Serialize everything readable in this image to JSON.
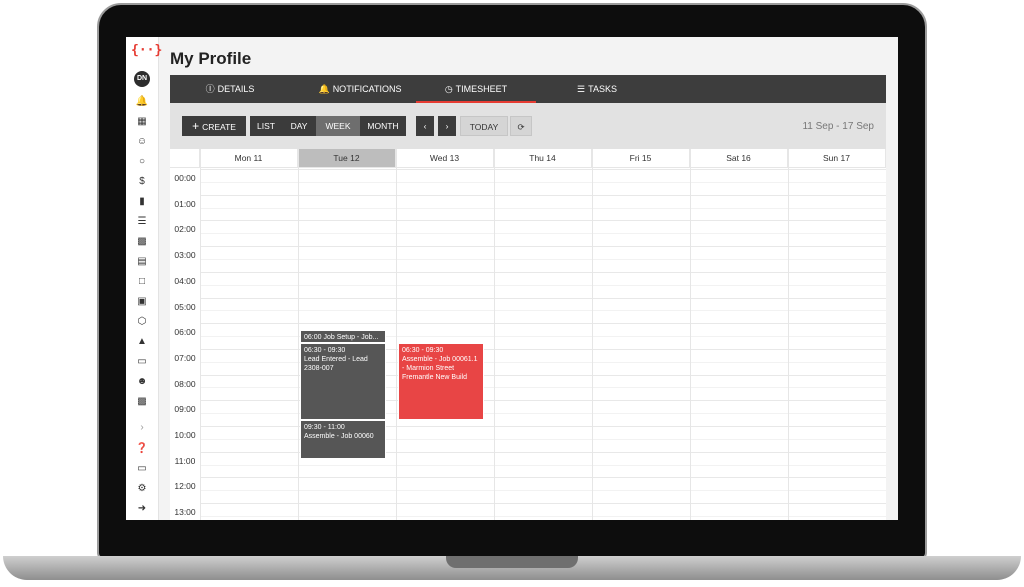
{
  "app": {
    "logo_text": "{··}",
    "avatar_initials": "DN",
    "page_title": "My Profile",
    "accent_color": "#e63b32"
  },
  "sidebar": {
    "icons": [
      "bell-icon",
      "grid-icon",
      "user-icon",
      "chat-icon",
      "dollar-icon",
      "document-icon",
      "list-icon",
      "calendar-icon",
      "chart-icon",
      "folder-icon",
      "book-icon",
      "box-icon",
      "cart-icon",
      "file-icon",
      "users-icon",
      "contacts-icon",
      "chevron-right-icon",
      "help-icon",
      "tablet-icon",
      "gear-icon",
      "logout-icon"
    ]
  },
  "tabs": [
    {
      "label": "Details",
      "icon": "info-icon"
    },
    {
      "label": "Notifications",
      "icon": "bell-icon"
    },
    {
      "label": "Timesheet",
      "icon": "clock-icon",
      "active": true
    },
    {
      "label": "Tasks",
      "icon": "task-list-icon"
    }
  ],
  "toolbar": {
    "create_label": "Create",
    "views": [
      "List",
      "Day",
      "Week",
      "Month"
    ],
    "active_view": "Week",
    "today_label": "Today",
    "date_range": "11 Sep - 17 Sep"
  },
  "calendar": {
    "days": [
      "Mon 11",
      "Tue 12",
      "Wed 13",
      "Thu 14",
      "Fri 15",
      "Sat 16",
      "Sun 17"
    ],
    "today_index": 1,
    "hours": [
      "00:00",
      "01:00",
      "02:00",
      "03:00",
      "04:00",
      "05:00",
      "06:00",
      "07:00",
      "08:00",
      "09:00",
      "10:00",
      "11:00",
      "12:00",
      "13:00"
    ],
    "events": [
      {
        "day": "Tue 12",
        "start": "06:00",
        "end": "06:30",
        "title": "06:00 Job Setup - Job...",
        "color": "dark"
      },
      {
        "day": "Tue 12",
        "start": "06:30",
        "end": "09:30",
        "time": "06:30 - 09:30",
        "title": "Lead Entered - Lead 2308-007",
        "color": "dark"
      },
      {
        "day": "Tue 12",
        "start": "09:30",
        "end": "11:00",
        "time": "09:30 - 11:00",
        "title": "Assemble - Job 00060",
        "color": "dark"
      },
      {
        "day": "Wed 13",
        "start": "06:30",
        "end": "09:30",
        "time": "06:30 - 09:30",
        "title": "Assemble - Job 00061.1 - Marmion Street Fremantle New Build",
        "color": "red"
      }
    ]
  }
}
